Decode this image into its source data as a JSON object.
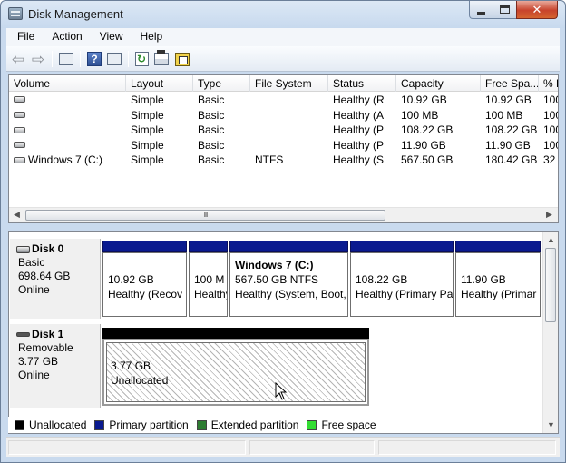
{
  "window": {
    "title": "Disk Management"
  },
  "menu": [
    "File",
    "Action",
    "View",
    "Help"
  ],
  "toolbar": {
    "icons": [
      "back-arrow-icon",
      "forward-arrow-icon",
      "show-hide-console-tree-icon",
      "help-icon",
      "show-hide-action-pane-icon",
      "refresh-icon",
      "properties-icon",
      "disk-settings-icon"
    ]
  },
  "columns": [
    "Volume",
    "Layout",
    "Type",
    "File System",
    "Status",
    "Capacity",
    "Free Spa...",
    "% F"
  ],
  "volumes": [
    {
      "volume": "",
      "layout": "Simple",
      "type": "Basic",
      "fs": "",
      "status": "Healthy (R",
      "capacity": "10.92 GB",
      "free": "10.92 GB",
      "pct": "100"
    },
    {
      "volume": "",
      "layout": "Simple",
      "type": "Basic",
      "fs": "",
      "status": "Healthy (A",
      "capacity": "100 MB",
      "free": "100 MB",
      "pct": "100"
    },
    {
      "volume": "",
      "layout": "Simple",
      "type": "Basic",
      "fs": "",
      "status": "Healthy (P",
      "capacity": "108.22 GB",
      "free": "108.22 GB",
      "pct": "100"
    },
    {
      "volume": "",
      "layout": "Simple",
      "type": "Basic",
      "fs": "",
      "status": "Healthy (P",
      "capacity": "11.90 GB",
      "free": "11.90 GB",
      "pct": "100"
    },
    {
      "volume": "Windows 7 (C:)",
      "layout": "Simple",
      "type": "Basic",
      "fs": "NTFS",
      "status": "Healthy (S",
      "capacity": "567.50 GB",
      "free": "180.42 GB",
      "pct": "32"
    }
  ],
  "scrollbar": {
    "grip": "III"
  },
  "disks": [
    {
      "name": "Disk 0",
      "kind": "Basic",
      "size": "698.64 GB",
      "state": "Online",
      "partitions": [
        {
          "title": "",
          "size": "10.92 GB",
          "status": "Healthy (Recov"
        },
        {
          "title": "",
          "size": "100 M",
          "status": "Healthy"
        },
        {
          "title": "Windows 7  (C:)",
          "size": "567.50 GB NTFS",
          "status": "Healthy (System, Boot,"
        },
        {
          "title": "",
          "size": "108.22 GB",
          "status": "Healthy (Primary Pa"
        },
        {
          "title": "",
          "size": "11.90 GB",
          "status": "Healthy (Primar"
        }
      ]
    },
    {
      "name": "Disk 1",
      "kind": "Removable",
      "size": "3.77 GB",
      "state": "Online",
      "partitions": [
        {
          "size": "3.77 GB",
          "status": "Unallocated"
        }
      ]
    }
  ],
  "legend": [
    {
      "label": "Unallocated",
      "color": "#000000"
    },
    {
      "label": "Primary partition",
      "color": "#0a1a8f"
    },
    {
      "label": "Extended partition",
      "color": "#2e7d32"
    },
    {
      "label": "Free space",
      "color": "#33dd33"
    }
  ]
}
